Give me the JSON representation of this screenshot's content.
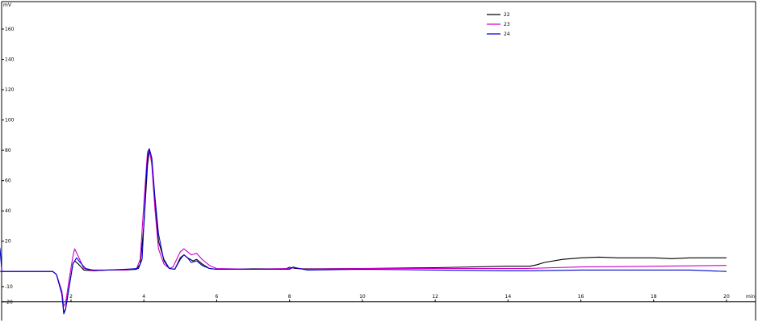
{
  "chart_data": {
    "type": "line",
    "title": "",
    "xlabel": "min",
    "ylabel": "mV",
    "xlim": [
      0,
      20.6
    ],
    "ylim": [
      -20,
      162
    ],
    "x_ticks": [
      2,
      4,
      6,
      8,
      10,
      12,
      14,
      16,
      18,
      20
    ],
    "y_ticks": [
      -20,
      -10,
      20,
      40,
      60,
      80,
      100,
      120,
      140,
      160
    ],
    "y_tick_labels": [
      "-20",
      "-10",
      "20",
      "40",
      "60",
      "80",
      "100",
      "120",
      "140",
      "160"
    ],
    "grid": false,
    "legend_position": "top-center",
    "series": [
      {
        "name": "22",
        "color": "#000000",
        "points": [
          [
            0,
            0
          ],
          [
            0.5,
            0
          ],
          [
            1,
            0
          ],
          [
            1.5,
            0
          ],
          [
            1.6,
            -2
          ],
          [
            1.75,
            -15
          ],
          [
            1.8,
            -27
          ],
          [
            1.85,
            -25
          ],
          [
            1.95,
            -10
          ],
          [
            2.05,
            5
          ],
          [
            2.1,
            7
          ],
          [
            2.2,
            5
          ],
          [
            2.35,
            1
          ],
          [
            2.6,
            0.5
          ],
          [
            3,
            1
          ],
          [
            3.5,
            1
          ],
          [
            3.8,
            1.5
          ],
          [
            3.9,
            5
          ],
          [
            4.0,
            30
          ],
          [
            4.1,
            70
          ],
          [
            4.15,
            80
          ],
          [
            4.22,
            72
          ],
          [
            4.3,
            45
          ],
          [
            4.4,
            20
          ],
          [
            4.55,
            8
          ],
          [
            4.7,
            2
          ],
          [
            4.85,
            1.5
          ],
          [
            5.0,
            9
          ],
          [
            5.1,
            11
          ],
          [
            5.2,
            9
          ],
          [
            5.35,
            7
          ],
          [
            5.45,
            8
          ],
          [
            5.6,
            5
          ],
          [
            5.8,
            2
          ],
          [
            6,
            1.5
          ],
          [
            7,
            1.8
          ],
          [
            7.9,
            1.8
          ],
          [
            8.0,
            2.8
          ],
          [
            8.15,
            2
          ],
          [
            8.4,
            1.8
          ],
          [
            10,
            2
          ],
          [
            12,
            2.5
          ],
          [
            14,
            3.5
          ],
          [
            14.5,
            3.5
          ],
          [
            14.6,
            3.5
          ],
          [
            14.8,
            4.5
          ],
          [
            15,
            6
          ],
          [
            15.5,
            8
          ],
          [
            16,
            9
          ],
          [
            16.5,
            9.5
          ],
          [
            17,
            9
          ],
          [
            17.5,
            9
          ],
          [
            18,
            9
          ],
          [
            18.5,
            8.5
          ],
          [
            19,
            9
          ],
          [
            20,
            9
          ]
        ]
      },
      {
        "name": "23",
        "color": "#cc00cc",
        "points": [
          [
            0,
            0
          ],
          [
            0.5,
            0
          ],
          [
            1,
            0
          ],
          [
            1.5,
            0
          ],
          [
            1.6,
            -2
          ],
          [
            1.75,
            -13
          ],
          [
            1.8,
            -23
          ],
          [
            1.85,
            -21
          ],
          [
            1.95,
            -5
          ],
          [
            2.05,
            10
          ],
          [
            2.1,
            15
          ],
          [
            2.2,
            10
          ],
          [
            2.35,
            2
          ],
          [
            2.6,
            0.5
          ],
          [
            3,
            1
          ],
          [
            3.5,
            1
          ],
          [
            3.8,
            2
          ],
          [
            3.9,
            8
          ],
          [
            4.0,
            45
          ],
          [
            4.1,
            79
          ],
          [
            4.15,
            81
          ],
          [
            4.22,
            70
          ],
          [
            4.3,
            42
          ],
          [
            4.4,
            15
          ],
          [
            4.55,
            5
          ],
          [
            4.7,
            2
          ],
          [
            4.8,
            3
          ],
          [
            4.9,
            8
          ],
          [
            5.0,
            13
          ],
          [
            5.1,
            15
          ],
          [
            5.2,
            13
          ],
          [
            5.3,
            11
          ],
          [
            5.45,
            12
          ],
          [
            5.6,
            8
          ],
          [
            5.8,
            4
          ],
          [
            6,
            2
          ],
          [
            7,
            1.5
          ],
          [
            8,
            2
          ],
          [
            8.15,
            2.5
          ],
          [
            8.4,
            1.5
          ],
          [
            10,
            2
          ],
          [
            12,
            2
          ],
          [
            14,
            2
          ],
          [
            14.5,
            2
          ],
          [
            16,
            3
          ],
          [
            18,
            3.5
          ],
          [
            20,
            4
          ]
        ]
      },
      {
        "name": "24",
        "color": "#0000cc",
        "points": [
          [
            0,
            19
          ],
          [
            0.05,
            15
          ],
          [
            0.1,
            0
          ],
          [
            0.5,
            0
          ],
          [
            1,
            0
          ],
          [
            1.5,
            0
          ],
          [
            1.6,
            -2
          ],
          [
            1.75,
            -15
          ],
          [
            1.8,
            -28
          ],
          [
            1.85,
            -25
          ],
          [
            1.95,
            -10
          ],
          [
            2.05,
            5
          ],
          [
            2.15,
            9
          ],
          [
            2.25,
            6
          ],
          [
            2.4,
            2
          ],
          [
            2.6,
            1
          ],
          [
            3,
            1
          ],
          [
            3.5,
            1.5
          ],
          [
            3.85,
            2
          ],
          [
            3.95,
            8
          ],
          [
            4.05,
            55
          ],
          [
            4.1,
            75
          ],
          [
            4.15,
            81
          ],
          [
            4.22,
            75
          ],
          [
            4.3,
            50
          ],
          [
            4.4,
            25
          ],
          [
            4.55,
            7
          ],
          [
            4.7,
            2
          ],
          [
            4.85,
            1.5
          ],
          [
            5.0,
            8
          ],
          [
            5.1,
            11
          ],
          [
            5.2,
            9
          ],
          [
            5.3,
            6
          ],
          [
            5.45,
            7
          ],
          [
            5.6,
            4
          ],
          [
            5.8,
            2
          ],
          [
            6,
            1.5
          ],
          [
            7,
            1.5
          ],
          [
            8,
            1.5
          ],
          [
            8.1,
            3
          ],
          [
            8.25,
            2
          ],
          [
            8.5,
            1
          ],
          [
            10,
            1.5
          ],
          [
            12,
            1
          ],
          [
            14,
            0.5
          ],
          [
            14.6,
            0.5
          ],
          [
            16,
            1
          ],
          [
            18,
            1
          ],
          [
            19,
            1
          ],
          [
            20,
            0
          ]
        ]
      }
    ]
  }
}
